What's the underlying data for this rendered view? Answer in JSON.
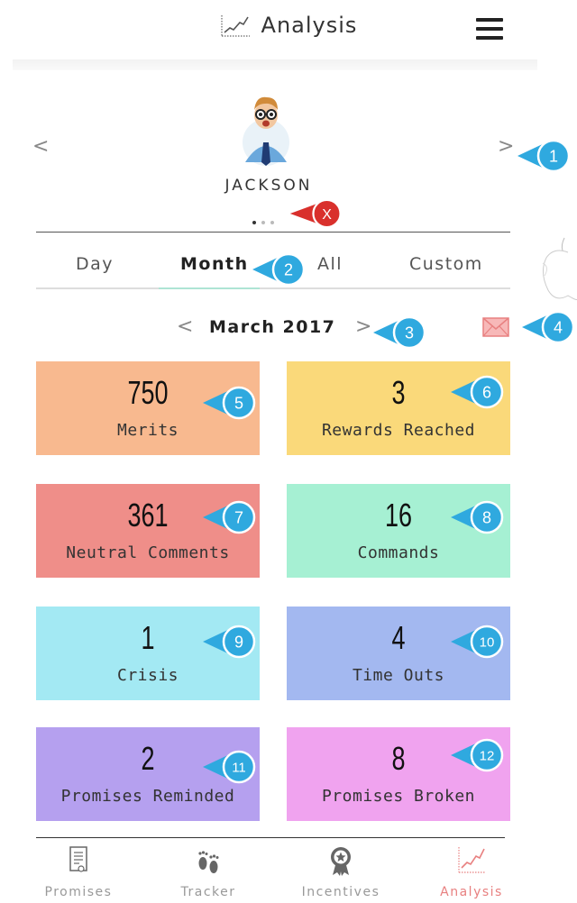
{
  "header": {
    "title": "Analysis",
    "chart_icon": "chart-line-icon",
    "menu_icon": "hamburger-menu-icon"
  },
  "child": {
    "name": "JACKSON",
    "prev": "<",
    "next": ">",
    "page_dots": 3,
    "active_dot": 0
  },
  "tabs": [
    {
      "label": "Day",
      "active": false
    },
    {
      "label": "Month",
      "active": true
    },
    {
      "label": "All",
      "active": false
    },
    {
      "label": "Custom",
      "active": false
    }
  ],
  "period": {
    "label": "March 2017",
    "prev": "<",
    "next": ">",
    "email_icon": "envelope-icon"
  },
  "stats": [
    {
      "value": "750",
      "label": "Merits",
      "color": "#f8b98f"
    },
    {
      "value": "3",
      "label": "Rewards Reached",
      "color": "#fad97a"
    },
    {
      "value": "361",
      "label": "Neutral Comments",
      "color": "#ef8e89"
    },
    {
      "value": "16",
      "label": "Commands",
      "color": "#a6f0d3"
    },
    {
      "value": "1",
      "label": "Crisis",
      "color": "#a3e9f3"
    },
    {
      "value": "4",
      "label": "Time Outs",
      "color": "#a3b8f0"
    },
    {
      "value": "2",
      "label": "Promises Reminded",
      "color": "#b5a0ef"
    },
    {
      "value": "8",
      "label": "Promises Broken",
      "color": "#f0a3ef"
    }
  ],
  "callouts": [
    "1",
    "2",
    "3",
    "4",
    "5",
    "6",
    "7",
    "8",
    "9",
    "10",
    "11",
    "12"
  ],
  "callout_x": "X",
  "colors": {
    "callout_blue": "#2fa9df",
    "callout_red": "#d9302c",
    "accent_pink": "#e88080"
  },
  "bottom_nav": [
    {
      "label": "Promises",
      "icon": "document-icon",
      "active": false
    },
    {
      "label": "Tracker",
      "icon": "footprints-icon",
      "active": false
    },
    {
      "label": "Incentives",
      "icon": "award-medal-icon",
      "active": false
    },
    {
      "label": "Analysis",
      "icon": "chart-line-icon",
      "active": true
    }
  ]
}
